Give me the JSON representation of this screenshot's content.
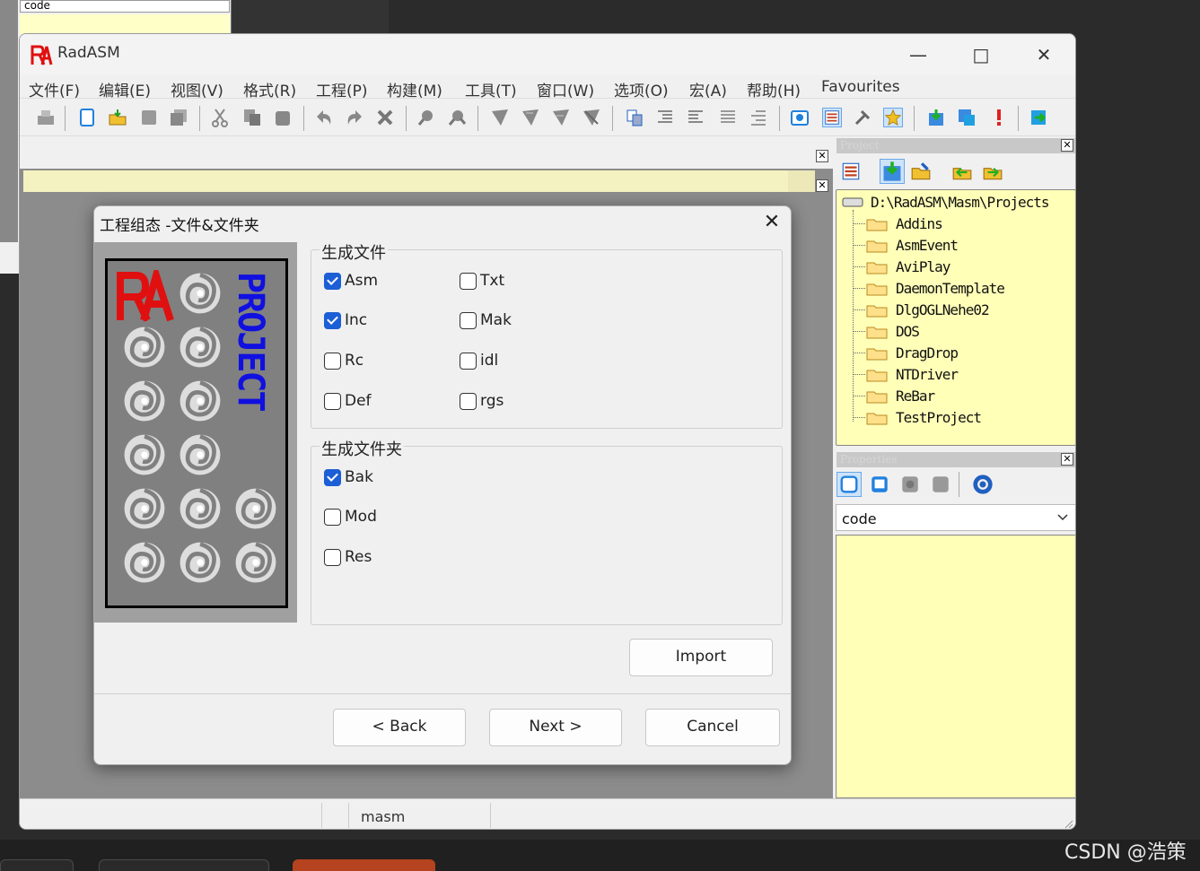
{
  "background": {
    "combo_value": "code"
  },
  "window": {
    "title": "RadASM",
    "logo_text": "RA",
    "controls": [
      "minimize-icon",
      "maximize-icon",
      "close-icon"
    ]
  },
  "menu": {
    "items": [
      "文件(F)",
      "编辑(E)",
      "视图(V)",
      "格式(R)",
      "工程(P)",
      "构建(M)",
      "工具(T)",
      "窗口(W)",
      "选项(O)",
      "宏(A)",
      "帮助(H)",
      "Favourites"
    ]
  },
  "project_panel": {
    "header": "Project",
    "root": "D:\\RadASM\\Masm\\Projects",
    "folders": [
      "Addins",
      "AsmEvent",
      "AviPlay",
      "DaemonTemplate",
      "DlgOGLNehe02",
      "DOS",
      "DragDrop",
      "NTDriver",
      "ReBar",
      "TestProject"
    ]
  },
  "properties_panel": {
    "header": "Properties",
    "combo_value": "code"
  },
  "statusbar": {
    "mode": "masm"
  },
  "dialog": {
    "title": "工程组态 -文件&文件夹",
    "image_text": "PROJECT",
    "files_group": {
      "title": "生成文件",
      "items": [
        {
          "label": "Asm",
          "checked": true
        },
        {
          "label": "Txt",
          "checked": false
        },
        {
          "label": "Inc",
          "checked": true
        },
        {
          "label": "Mak",
          "checked": false
        },
        {
          "label": "Rc",
          "checked": false
        },
        {
          "label": "idl",
          "checked": false
        },
        {
          "label": "Def",
          "checked": false
        },
        {
          "label": "rgs",
          "checked": false
        }
      ]
    },
    "folders_group": {
      "title": "生成文件夹",
      "items": [
        {
          "label": "Bak",
          "checked": true
        },
        {
          "label": "Mod",
          "checked": false
        },
        {
          "label": "Res",
          "checked": false
        }
      ]
    },
    "import_label": "Import",
    "back_label": "< Back",
    "next_label": "Next >",
    "cancel_label": "Cancel"
  },
  "watermark": "CSDN @浩策",
  "colors": {
    "accent": "#1c5ed6",
    "panel_yellow": "#ffffb8",
    "logo_red": "#e01010",
    "project_blue": "#1010e0"
  }
}
